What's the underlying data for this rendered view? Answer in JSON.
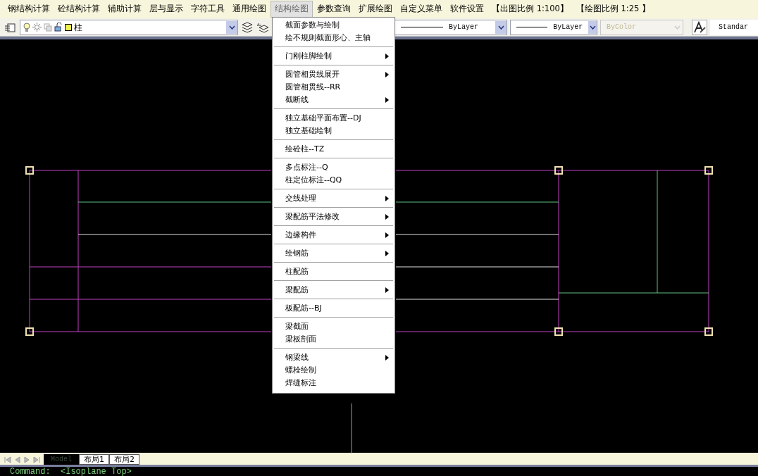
{
  "menubar": [
    {
      "label": "钢结构计算",
      "selected": false
    },
    {
      "label": "砼结构计算",
      "selected": false
    },
    {
      "label": "辅助计算",
      "selected": false
    },
    {
      "label": "层与显示",
      "selected": false
    },
    {
      "label": "字符工具",
      "selected": false
    },
    {
      "label": "通用绘图",
      "selected": false
    },
    {
      "label": "结构绘图",
      "selected": true
    },
    {
      "label": "参数查询",
      "selected": false
    },
    {
      "label": "扩展绘图",
      "selected": false
    },
    {
      "label": "自定义菜单",
      "selected": false
    },
    {
      "label": "软件设置",
      "selected": false
    },
    {
      "label": "【出图比例 1:100】",
      "selected": false
    },
    {
      "label": "【绘图比例 1:25 】",
      "selected": false
    }
  ],
  "toolbar": {
    "layer": "柱",
    "linetype": "ByLayer",
    "lineweight": "ByLayer",
    "plot_style": {
      "value": "ByColor",
      "disabled": true
    },
    "text_style": "Standar"
  },
  "menu": [
    [
      {
        "label": "截面参数与绘制",
        "submenu": false
      },
      {
        "label": "绘不规则截面形心、主轴",
        "submenu": false
      }
    ],
    [
      {
        "label": "门刚柱脚绘制",
        "submenu": true
      }
    ],
    [
      {
        "label": "圆管相贯线展开",
        "submenu": true
      },
      {
        "label": "圆管相贯线--RR",
        "submenu": false
      },
      {
        "label": "截断线",
        "submenu": true
      }
    ],
    [
      {
        "label": "独立基础平面布置--DJ",
        "submenu": false
      },
      {
        "label": "独立基础绘制",
        "submenu": false
      }
    ],
    [
      {
        "label": "绘砼柱--TZ",
        "submenu": false
      }
    ],
    [
      {
        "label": "多点标注--Q",
        "submenu": false
      },
      {
        "label": "柱定位标注--QQ",
        "submenu": false
      }
    ],
    [
      {
        "label": "交线处理",
        "submenu": true
      }
    ],
    [
      {
        "label": "梁配筋平法修改",
        "submenu": true
      }
    ],
    [
      {
        "label": "边缘构件",
        "submenu": true
      }
    ],
    [
      {
        "label": "绘钢筋",
        "submenu": true
      }
    ],
    [
      {
        "label": "柱配筋",
        "submenu": false
      }
    ],
    [
      {
        "label": "梁配筋",
        "submenu": true
      }
    ],
    [
      {
        "label": "板配筋--BJ",
        "submenu": false
      }
    ],
    [
      {
        "label": "梁截面",
        "submenu": false
      },
      {
        "label": "梁板剖面",
        "submenu": false
      }
    ],
    [
      {
        "label": "钢梁线",
        "submenu": true
      },
      {
        "label": "螺栓绘制",
        "submenu": false
      },
      {
        "label": "焊缝标注",
        "submenu": false
      }
    ]
  ],
  "layout_tabs": [
    {
      "label": "Model",
      "selected": true
    },
    {
      "label": "布局1",
      "selected": false
    },
    {
      "label": "布局2",
      "selected": false
    }
  ],
  "command_line": "Command:  <Isoplane Top>"
}
